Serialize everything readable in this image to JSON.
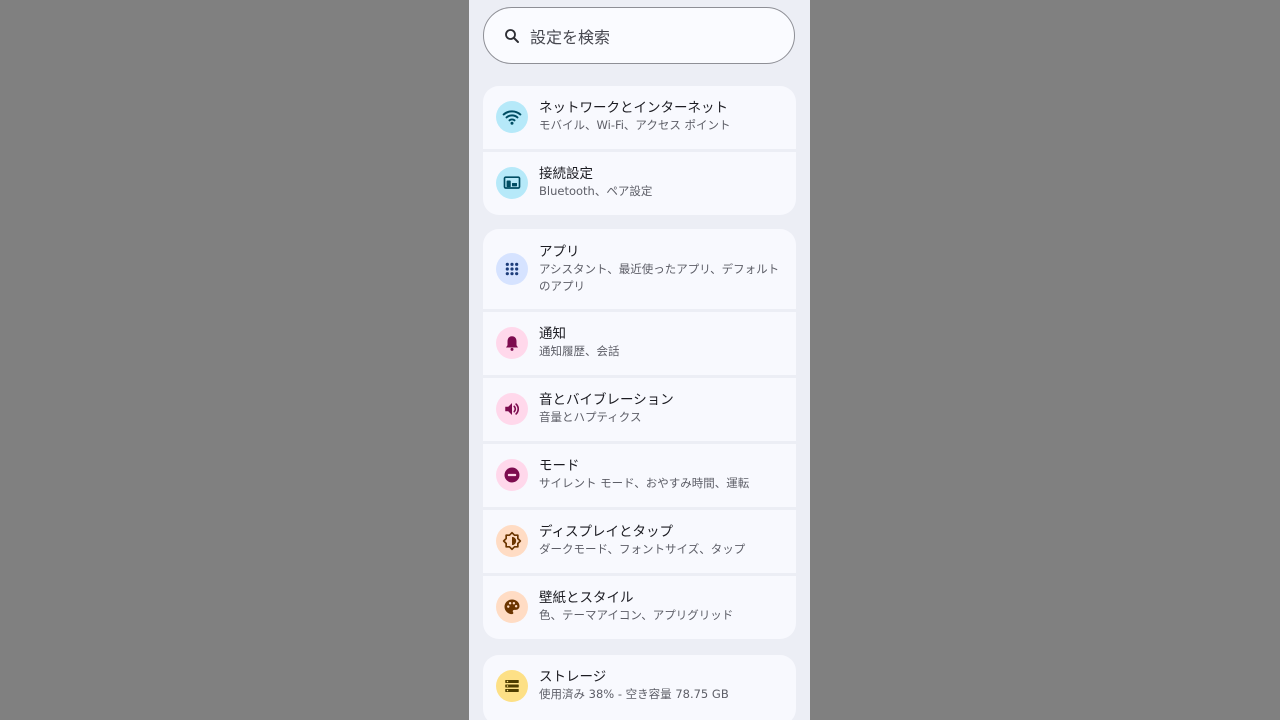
{
  "search": {
    "placeholder": "設定を検索"
  },
  "groups": [
    {
      "items": [
        {
          "title": "ネットワークとインターネット",
          "subtitle": "モバイル、Wi-Fi、アクセス ポイント",
          "icon": "wifi-icon",
          "icon_bg": "#b6e9f9",
          "icon_color": "#004d63"
        },
        {
          "title": "接続設定",
          "subtitle": "Bluetooth、ペア設定",
          "icon": "devices-icon",
          "icon_bg": "#b6e9f9",
          "icon_color": "#004d63"
        }
      ]
    },
    {
      "items": [
        {
          "title": "アプリ",
          "subtitle": "アシスタント、最近使ったアプリ、デフォルトのアプリ",
          "icon": "apps-grid-icon",
          "icon_bg": "#d6e3ff",
          "icon_color": "#1d3d7a"
        },
        {
          "title": "通知",
          "subtitle": "通知履歴、会話",
          "icon": "bell-icon",
          "icon_bg": "#ffd8eb",
          "icon_color": "#7d0c4f"
        },
        {
          "title": "音とバイブレーション",
          "subtitle": "音量とハプティクス",
          "icon": "volume-icon",
          "icon_bg": "#ffd8eb",
          "icon_color": "#7d0c4f"
        },
        {
          "title": "モード",
          "subtitle": "サイレント モード、おやすみ時間、運転",
          "icon": "do-not-disturb-icon",
          "icon_bg": "#ffd8eb",
          "icon_color": "#7d0c4f"
        },
        {
          "title": "ディスプレイとタップ",
          "subtitle": "ダークモード、フォントサイズ、タップ",
          "icon": "brightness-icon",
          "icon_bg": "#ffdcc4",
          "icon_color": "#6b3500"
        },
        {
          "title": "壁紙とスタイル",
          "subtitle": "色、テーマアイコン、アプリグリッド",
          "icon": "palette-icon",
          "icon_bg": "#ffdcc4",
          "icon_color": "#6b3500"
        }
      ]
    },
    {
      "items": [
        {
          "title": "ストレージ",
          "subtitle": "使用済み 38% - 空き容量 78.75 GB",
          "icon": "storage-icon",
          "icon_bg": "#fde086",
          "icon_color": "#4e3d00"
        }
      ]
    }
  ]
}
